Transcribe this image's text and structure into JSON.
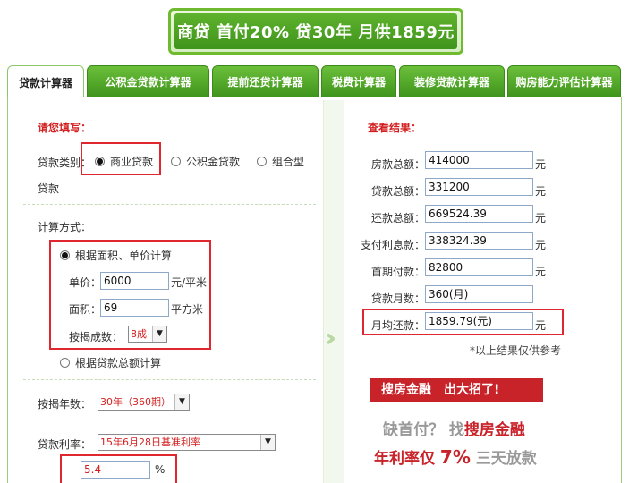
{
  "banner": {
    "text": "商贷 首付20% 贷30年 月供1859元"
  },
  "tabs": [
    {
      "label": "贷款计算器",
      "active": true
    },
    {
      "label": "公积金贷款计算器"
    },
    {
      "label": "提前还贷计算器"
    },
    {
      "label": "税费计算器"
    },
    {
      "label": "装修贷款计算器"
    },
    {
      "label": "购房能力评估计算器"
    }
  ],
  "form": {
    "title": "请您填写：",
    "loan_type_label": "贷款类别：",
    "loan_types": [
      "商业贷款",
      "公积金贷款",
      "组合型"
    ],
    "loan_type_wrap": "贷款",
    "calc_method_label": "计算方式：",
    "method_by_area": "根据面积、单价计算",
    "unit_price_label": "单价：",
    "unit_price": "6000",
    "unit_price_unit": "元/平米",
    "area_label": "面积：",
    "area": "69",
    "area_unit": "平方米",
    "ratio_label": "按揭成数：",
    "ratio": "8成",
    "method_by_total": "根据贷款总额计算",
    "years_label": "按揭年数：",
    "years": "30年（360期）",
    "rate_label": "贷款利率：",
    "rate_option": "15年6月28日基准利率",
    "rate_value": "5.4",
    "rate_unit": "%"
  },
  "results": {
    "title": "查看结果：",
    "house_total_label": "房款总额：",
    "house_total": "414000",
    "loan_total_label": "贷款总额：",
    "loan_total": "331200",
    "repay_total_label": "还款总额：",
    "repay_total": "669524.39",
    "interest_label": "支付利息款：",
    "interest": "338324.39",
    "down_payment_label": "首期付款：",
    "down_payment": "82800",
    "months_label": "贷款月数：",
    "months": "360(月)",
    "monthly_label": "月均还款：",
    "monthly": "1859.79(元)",
    "unit_yuan": "元",
    "note": "*以上结果仅供参考"
  },
  "ad": {
    "banner": "搜房金融　出大招了!",
    "line1_a": "缺首付？ 找",
    "line1_b": "搜房金融",
    "line2_a": "年利率仅",
    "line2_b": "7%",
    "line2_c": "三天放款"
  },
  "colors": {
    "accent_green": "#4fa524",
    "highlight_red": "#e0272f",
    "title_red": "#d31f1f"
  }
}
